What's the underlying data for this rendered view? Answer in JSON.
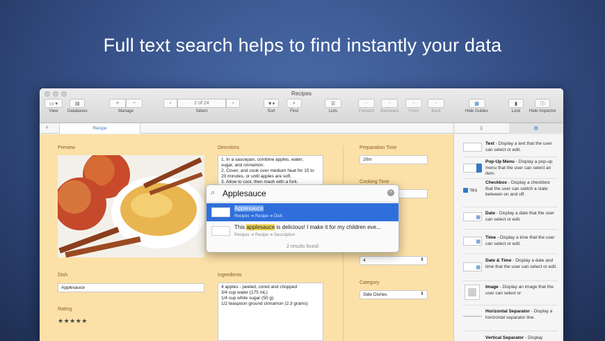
{
  "headline": "Full text search helps to find instantly your data",
  "window": {
    "title": "Recipes",
    "toolbar": {
      "view": "View",
      "databases": "Databases",
      "manage": "Manage",
      "manage_add": "+",
      "manage_remove": "−",
      "select_prev": "‹",
      "select_record": "2 of 24",
      "select_next": "›",
      "select": "Select",
      "sort": "Sort",
      "find": "Find",
      "lists": "Lists",
      "forward": "Forward",
      "backward": "Backward",
      "front": "Front",
      "back": "Back",
      "hide_guides": "Hide Guides",
      "lock": "Lock",
      "hide_inspector": "Hide Inspector"
    },
    "tabs": {
      "add": "+",
      "active": "Recipe"
    },
    "inspector_tabs": [
      "⇩",
      "⚙"
    ]
  },
  "form": {
    "preview_label": "Preview",
    "directions_label": "Directions",
    "directions": [
      "1. In a saucepan, combine apples, water,",
      "sugar, and cinnamon.",
      "2. Cover, and cook over medium heat for 15 to",
      "20 minutes, or until apples are soft.",
      "3. Allow to cool, then mash with a fork."
    ],
    "prep_label": "Preparation Time",
    "prep_value": "20m",
    "cooking_label": "Cooking Time",
    "servings_value": "4",
    "dish_label": "Dish",
    "dish_value": "Applesauce",
    "rating_label": "Rating",
    "rating_stars": "★★★★★",
    "ingredients_label": "Ingredients",
    "ingredients": [
      "4 apples - peeled, cored and chopped",
      "3/4 cup water (175 mL)",
      "1/4 cup white sugar (50 g)",
      "1/2 teaspoon ground cinnamon (2.3 grams)"
    ],
    "category_label": "Category",
    "category_value": "Side Dishes"
  },
  "search": {
    "query": "Applesauce",
    "results": [
      {
        "title": "Applesauce",
        "path": "Recipes ➔ Recipe ➔ Dish",
        "selected": true
      },
      {
        "title_before": "This ",
        "title_match": "applesauce",
        "title_after": " is delicious! I make it for my children eve...",
        "path": "Recipes ➔ Recipe ➔ Description",
        "selected": false
      }
    ],
    "footer": "2 results found"
  },
  "inspector": {
    "items": [
      {
        "name": "Text",
        "desc": " - Display a text that the user can select or edit."
      },
      {
        "name": "Pop-Up Menu",
        "desc": " - Display a pop-up menu that the user can select an item."
      },
      {
        "name": "Checkbox",
        "desc": " - Display a checkbox that the user can switch a state between on and off.",
        "preview": "Yes"
      },
      {
        "name": "Date",
        "desc": " - Display a date that the user can select or edit."
      },
      {
        "name": "Time",
        "desc": " - Display a time that the user can select or edit."
      },
      {
        "name": "Date & Time",
        "desc": " - Display a date and time that the user can select or edit."
      },
      {
        "name": "Image",
        "desc": " - Display an image that the user can select or"
      },
      {
        "name": "Horizontal Separator",
        "desc": " - Display a horizontal separator line."
      },
      {
        "name": "Vertical Separator",
        "desc": " - Display"
      }
    ]
  },
  "colors": {
    "form_bg": "#fbe1a7",
    "accent": "#2f6fdc",
    "label": "#8a5a2a"
  }
}
